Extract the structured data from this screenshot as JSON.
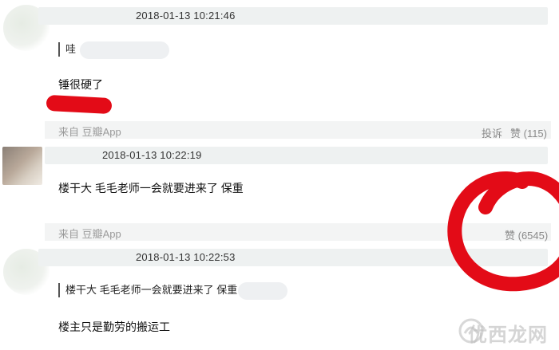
{
  "comments": [
    {
      "timestamp": "2018-01-13 10:21:46",
      "quote": "哇",
      "text": "锤很硬了",
      "source": "来自 豆瓣App",
      "report_label": "投诉",
      "like_label": "赞 (115)"
    },
    {
      "timestamp": "2018-01-13 10:22:19",
      "text": "楼干大  毛毛老师一会就要进来了  保重",
      "source": "来自 豆瓣App",
      "like_label": "赞 (6545)"
    },
    {
      "timestamp": "2018-01-13 10:22:53",
      "quote": "楼干大  毛毛老师一会就要进来了  保重",
      "text": "楼主只是勤劳的搬运工"
    }
  ],
  "watermark": "优西龙网",
  "annotation_color": "#e30b17"
}
